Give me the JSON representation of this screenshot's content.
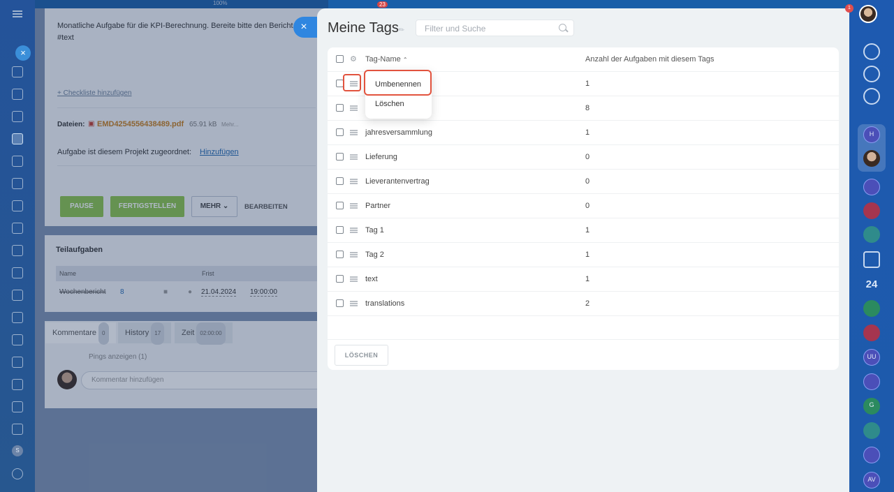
{
  "top": {
    "zoom": "100%",
    "notif_count": "23",
    "right_badge": "1"
  },
  "task": {
    "description": "Monatliche Aufgabe für die KPI-Berechnung. Bereite bitte den Bericht",
    "hashtag": "#text",
    "checklist_link": "+ Checkliste hinzufügen",
    "files_label": "Dateien:",
    "file_name": "EMD4254556438489.pdf",
    "file_size": "65.91 kB",
    "file_more": "Mehr...",
    "project_label": "Aufgabe ist diesem Projekt zugeordnet:",
    "project_link": "Hinzufügen",
    "buttons": {
      "pause": "PAUSE",
      "finish": "FERTIGSTELLEN",
      "more": "MEHR",
      "edit": "BEARBEITEN"
    }
  },
  "subtasks": {
    "title": "Teilaufgaben",
    "col_name": "Name",
    "col_deadline": "Frist",
    "row_name": "Wochenbericht",
    "row_count": "8",
    "row_date": "21.04.2024",
    "row_time": "19:00:00"
  },
  "comments": {
    "tabs": [
      {
        "label": "Kommentare",
        "count": "0"
      },
      {
        "label": "History",
        "count": "17"
      },
      {
        "label": "Zeit",
        "count": "02:00:00"
      }
    ],
    "pings": "Pings anzeigen (1)",
    "placeholder": "Kommentar hinzufügen"
  },
  "slider": {
    "title": "Meine Tags",
    "search_placeholder": "Filter und Suche",
    "col_name": "Tag-Name",
    "col_count": "Anzahl der Aufgaben mit diesem Tags",
    "rows": [
      {
        "name": "",
        "count": "1"
      },
      {
        "name": "",
        "count": "8"
      },
      {
        "name": "jahresversammlung",
        "count": "1"
      },
      {
        "name": "Lieferung",
        "count": "0"
      },
      {
        "name": "Lieverantenvertrag",
        "count": "0"
      },
      {
        "name": "Partner",
        "count": "0"
      },
      {
        "name": "Tag 1",
        "count": "1"
      },
      {
        "name": "Tag 2",
        "count": "1"
      },
      {
        "name": "text",
        "count": "1"
      },
      {
        "name": "translations",
        "count": "2"
      }
    ],
    "popup": {
      "rename": "Umbenennen",
      "delete": "Löschen"
    },
    "delete_button": "LÖSCHEN"
  },
  "right_bar": {
    "calendar_day": "24",
    "avatar_initials": [
      "H",
      "G",
      "AV",
      "UU"
    ]
  },
  "left_bar": {
    "badge": "S"
  },
  "colors": {
    "accent": "#2f86e0",
    "highlight": "#e2533e",
    "green": "#8ac44a"
  }
}
